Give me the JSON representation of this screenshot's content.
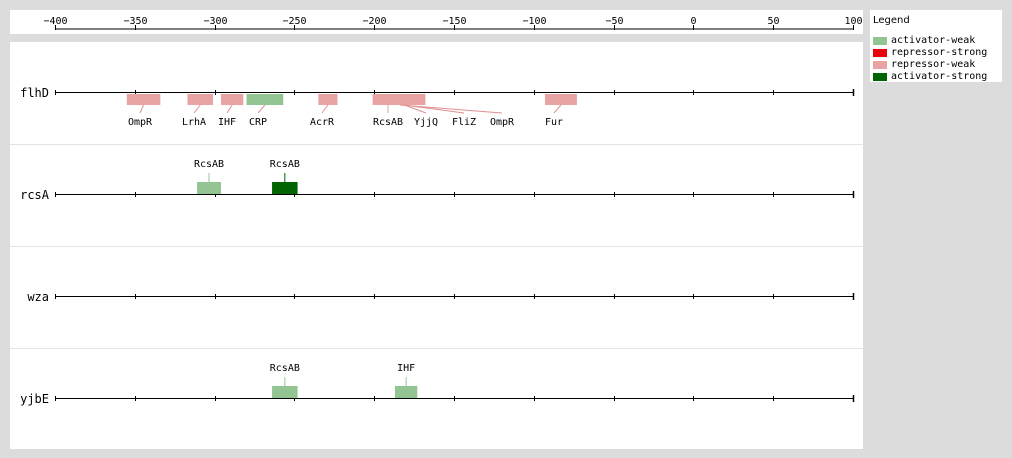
{
  "axis": {
    "ticks": [
      -400,
      -350,
      -300,
      -250,
      -200,
      -150,
      -100,
      -50,
      0,
      50,
      100
    ],
    "range": [
      -400,
      100
    ]
  },
  "legend": {
    "title": "Legend",
    "items": [
      {
        "label": "activator-weak",
        "color": "#93c593"
      },
      {
        "label": "repressor-strong",
        "color": "#e8000b"
      },
      {
        "label": "repressor-weak",
        "color": "#e8a3a3"
      },
      {
        "label": "activator-strong",
        "color": "#006400"
      }
    ]
  },
  "types": {
    "activator-weak": "#93c593",
    "repressor-strong": "#e8000b",
    "repressor-weak": "#e8a3a3",
    "activator-strong": "#006400"
  },
  "genes": [
    {
      "name": "flhD",
      "sites": [
        {
          "name": "OmpR",
          "start": -355,
          "end": -334,
          "type": "repressor-weak",
          "side": "below"
        },
        {
          "name": "LrhA",
          "start": -317,
          "end": -301,
          "type": "repressor-weak",
          "side": "below"
        },
        {
          "name": "IHF",
          "start": -296,
          "end": -282,
          "type": "repressor-weak",
          "side": "below"
        },
        {
          "name": "CRP",
          "start": -280,
          "end": -257,
          "type": "activator-weak",
          "side": "below"
        },
        {
          "name": "AcrR",
          "start": -235,
          "end": -223,
          "type": "repressor-weak",
          "side": "below"
        },
        {
          "name": "RcsAB",
          "start": -201,
          "end": -183,
          "type": "repressor-weak",
          "side": "below"
        },
        {
          "name": "YjjQ",
          "start": -190,
          "end": -172,
          "type": "repressor-weak",
          "side": "below"
        },
        {
          "name": "FliZ",
          "start": -195,
          "end": -168,
          "type": "repressor-weak",
          "side": "below"
        },
        {
          "name": "OmpR",
          "start": -200,
          "end": -168,
          "type": "repressor-weak",
          "side": "below"
        },
        {
          "name": "Fur",
          "start": -93,
          "end": -73,
          "type": "repressor-weak",
          "side": "below"
        }
      ]
    },
    {
      "name": "rcsA",
      "sites": [
        {
          "name": "RcsAB",
          "start": -311,
          "end": -296,
          "type": "activator-weak",
          "side": "above"
        },
        {
          "name": "RcsAB",
          "start": -264,
          "end": -248,
          "type": "activator-strong",
          "side": "above"
        }
      ]
    },
    {
      "name": "wza",
      "sites": []
    },
    {
      "name": "yjbE",
      "sites": [
        {
          "name": "RcsAB",
          "start": -264,
          "end": -248,
          "type": "activator-weak",
          "side": "above"
        },
        {
          "name": "IHF",
          "start": -187,
          "end": -173,
          "type": "activator-weak",
          "side": "above"
        }
      ]
    }
  ]
}
